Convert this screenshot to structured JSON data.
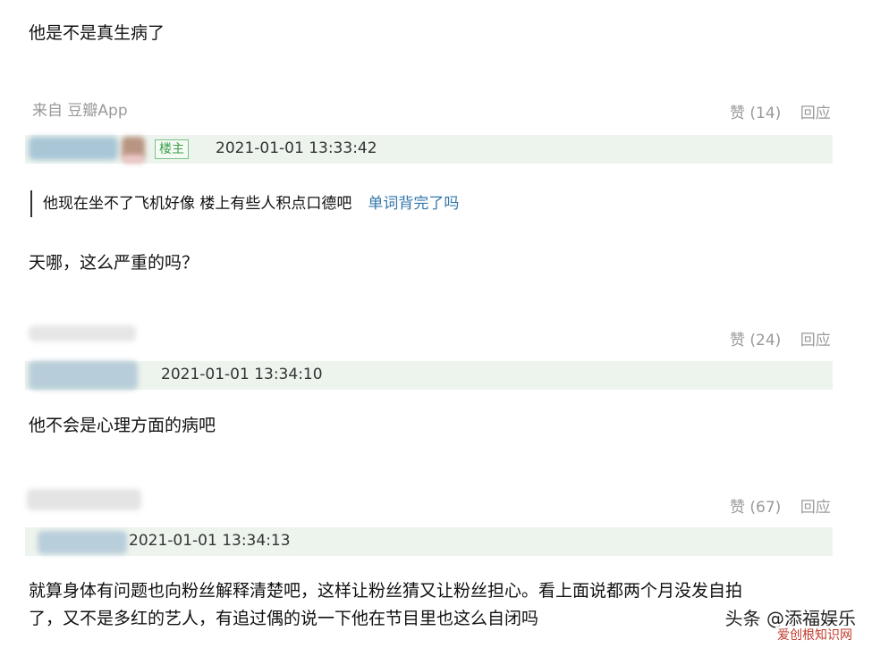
{
  "comments": [
    {
      "text": "他是不是真生病了",
      "source": "来自 豆瓣App",
      "likes_label": "赞 (14)",
      "reply_label": "回应",
      "badge": "楼主",
      "timestamp": "2021-01-01 13:33:42"
    },
    {
      "quote": {
        "text": "他现在坐不了飞机好像 楼上有些人积点口德吧",
        "author_link": "单词背完了吗"
      },
      "text": "天哪，这么严重的吗？",
      "likes_label": "赞 (24)",
      "reply_label": "回应",
      "timestamp": "2021-01-01 13:34:10"
    },
    {
      "text": "他不会是心理方面的病吧",
      "likes_label": "赞 (67)",
      "reply_label": "回应",
      "timestamp": "2021-01-01 13:34:13"
    },
    {
      "text_line1": "就算身体有问题也向粉丝解释清楚吧，这样让粉丝猜又让粉丝担心。看上面说都两个月没发自拍",
      "text_line2": "了，又不是多红的艺人，有追过偶的说一下他在节目里也这么自闭吗"
    }
  ],
  "watermark": {
    "main": "头条 @添福娱乐",
    "sub": "爱创根知识网"
  },
  "colors": {
    "author_bar": "#edf4ed",
    "link": "#3377aa",
    "badge": "#3c9e4a",
    "muted": "#9a9a9a"
  }
}
